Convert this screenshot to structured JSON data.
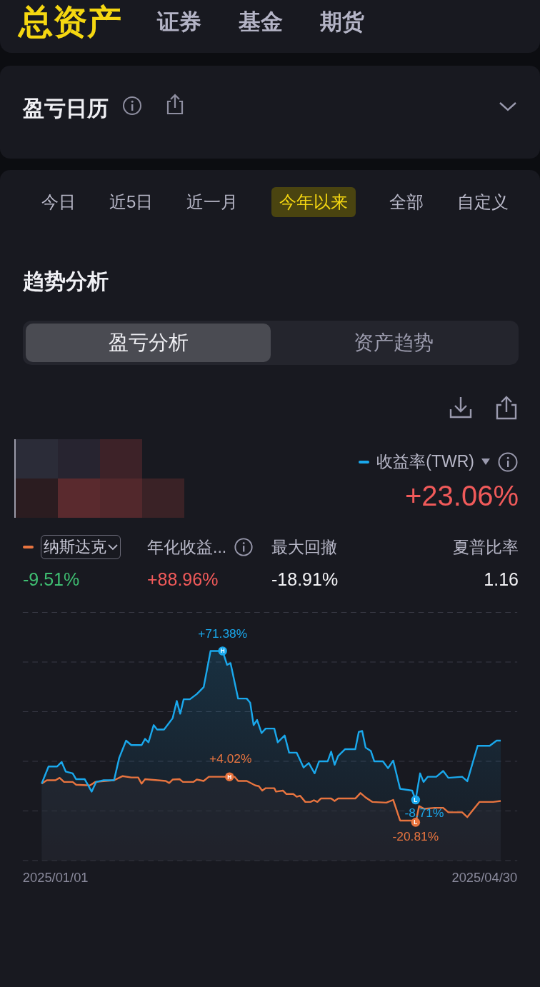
{
  "header": {
    "title": "总资产",
    "tabs": [
      {
        "label": "证券"
      },
      {
        "label": "基金"
      },
      {
        "label": "期货"
      }
    ]
  },
  "calendar": {
    "title": "盈亏日历",
    "expanded": false
  },
  "periods": [
    {
      "label": "今日",
      "selected": false
    },
    {
      "label": "近5日",
      "selected": false
    },
    {
      "label": "近一月",
      "selected": false
    },
    {
      "label": "今年以来",
      "selected": true
    },
    {
      "label": "全部",
      "selected": false
    },
    {
      "label": "自定义",
      "selected": false
    }
  ],
  "section_title": "趋势分析",
  "segments": [
    {
      "label": "盈亏分析",
      "selected": true
    },
    {
      "label": "资产趋势",
      "selected": false
    }
  ],
  "summary": {
    "metric": {
      "text": "收益率(TWR)",
      "color": "#1aa8ec"
    },
    "value": {
      "text": "+23.06%",
      "color": "#f05a5a"
    }
  },
  "stats": [
    {
      "kind": "benchmark",
      "label": {
        "text": "纳斯达克",
        "color": "#e8743f"
      },
      "value": {
        "text": "-9.51%",
        "color": "#3fbf72"
      }
    },
    {
      "kind": "info",
      "label": {
        "text": "年化收益..."
      },
      "value": {
        "text": "+88.96%",
        "color": "#f05a5a"
      }
    },
    {
      "kind": "plain",
      "label": {
        "text": "最大回撤"
      },
      "value": {
        "text": "-18.91%",
        "color": "#f2f2f5"
      }
    },
    {
      "kind": "plain",
      "label": {
        "text": "夏普比率"
      },
      "value": {
        "text": "1.16",
        "color": "#f2f2f5"
      }
    }
  ],
  "chart": {
    "start_date": "2025/01/01",
    "end_date": "2025/04/30",
    "markers": [
      {
        "letter": "H",
        "label": "+71.38%",
        "color": "#1aa8ec"
      },
      {
        "letter": "H",
        "label": "+4.02%",
        "color": "#e8743f"
      },
      {
        "letter": "L",
        "label": "-8.71%",
        "color": "#1aa8ec"
      },
      {
        "letter": "L",
        "label": "-20.81%",
        "color": "#e8743f"
      }
    ]
  }
}
